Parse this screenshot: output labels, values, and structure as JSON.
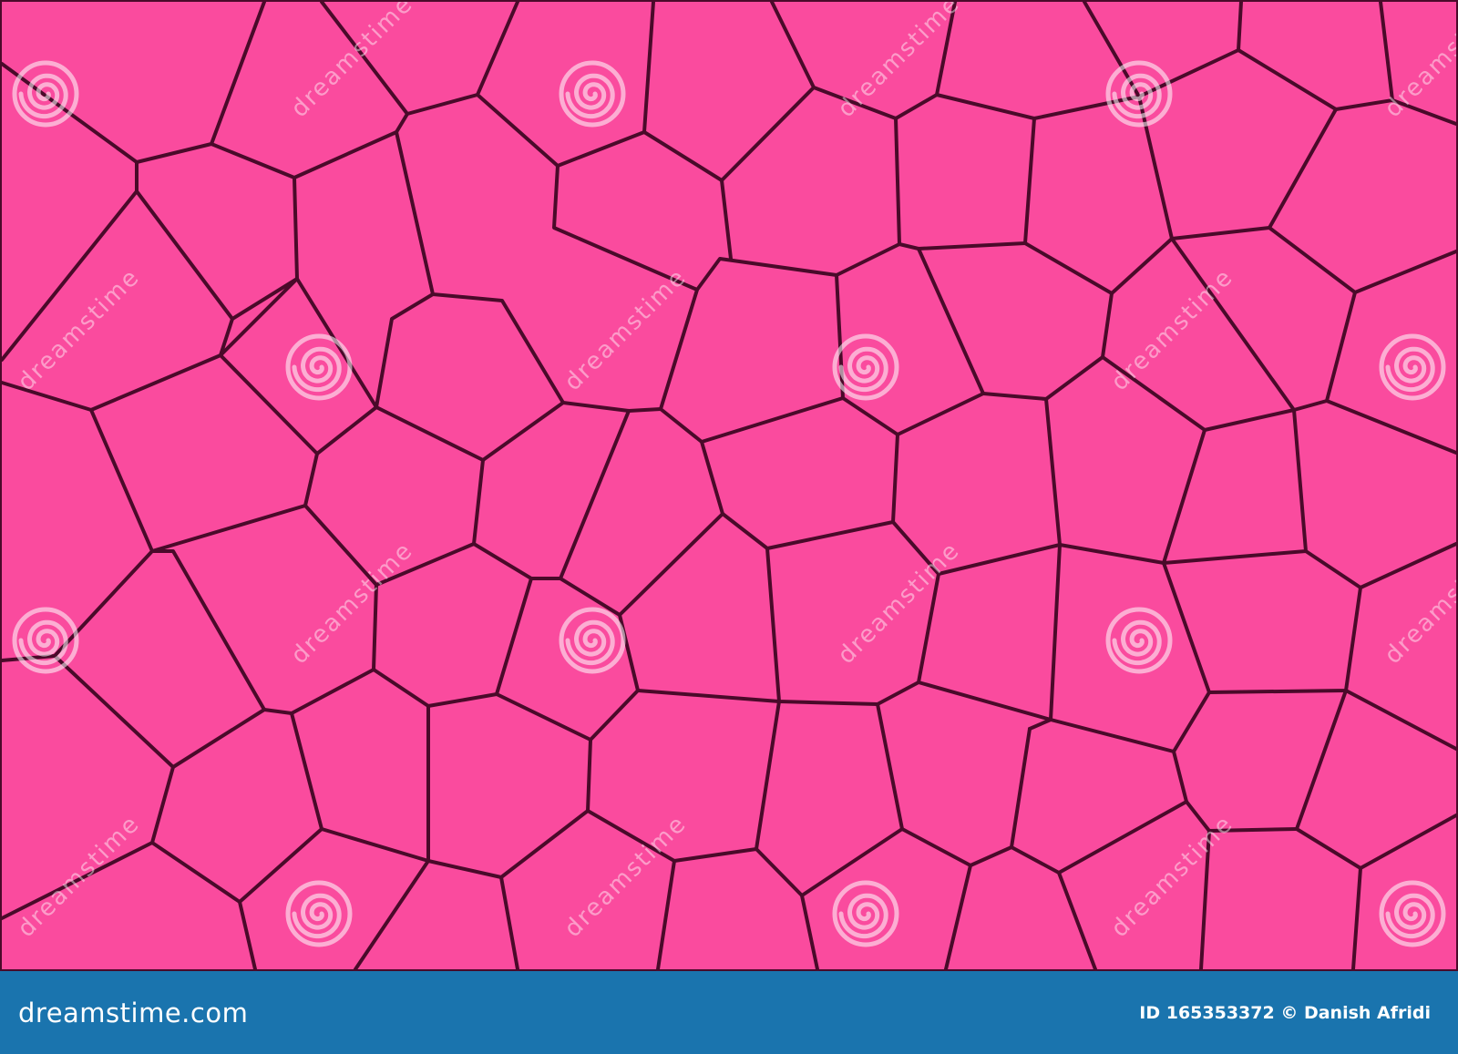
{
  "colors": {
    "tile_fill": "#fa4b9e",
    "outline": "#4a0a2a",
    "footer_bg": "#1a74ae",
    "watermark": "#ffffff"
  },
  "watermark": {
    "icon": "spiral-logo-icon",
    "text": "dreamstime"
  },
  "footer": {
    "brand": "dreamstime.com",
    "credit": "ID 165353372 © Danish Afridi"
  }
}
